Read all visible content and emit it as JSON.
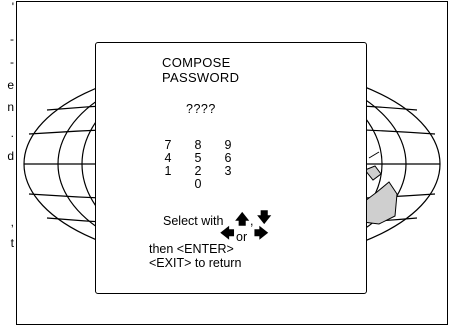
{
  "page_fragments": [
    "'",
    "-",
    "-",
    "e",
    "n",
    ".",
    "d",
    ",",
    "t"
  ],
  "menu": {
    "title_line1": "COMPOSE",
    "title_line2": "PASSWORD",
    "password_value": "????",
    "keypad": [
      "7",
      "8",
      "9",
      "4",
      "5",
      "6",
      "1",
      "2",
      "3",
      "0"
    ],
    "select_text": "Select with",
    "comma": ",",
    "or_text": "or",
    "then_text": "then <ENTER>",
    "exit_text": "<EXIT> to return"
  },
  "icons": {
    "up": "arrow-up-icon",
    "down": "arrow-down-icon",
    "left": "arrow-left-icon",
    "right": "arrow-right-icon"
  },
  "colors": {
    "foreground": "#000000",
    "background": "#ffffff"
  }
}
